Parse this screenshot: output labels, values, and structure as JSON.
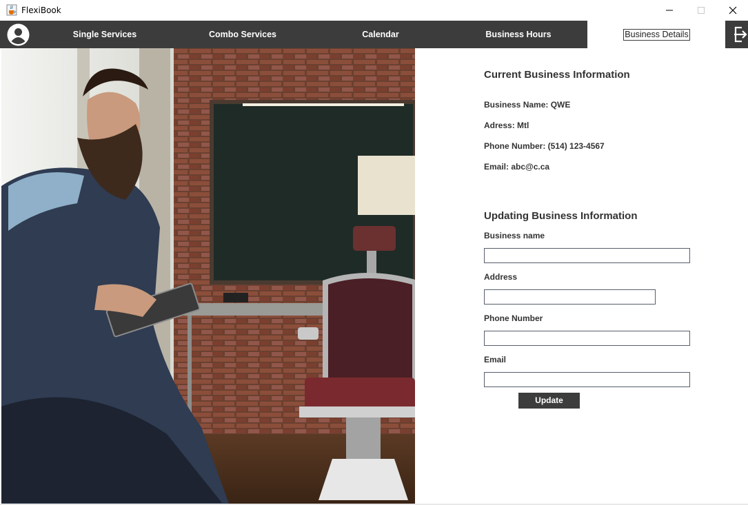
{
  "window": {
    "title": "FlexiBook"
  },
  "nav": {
    "items": [
      {
        "label": "Single Services"
      },
      {
        "label": "Combo Services"
      },
      {
        "label": "Calendar"
      },
      {
        "label": "Business Hours"
      },
      {
        "label": "Business Details"
      }
    ],
    "active_index": 4,
    "bar_color": "#3c3c3c"
  },
  "current": {
    "heading": "Current Business Information",
    "name_line": "Business Name: QWE",
    "address_line": "Adress: Mtl",
    "phone_line": "Phone Number: (514) 123-4567",
    "email_line": "Email: abc@c.ca"
  },
  "update": {
    "heading": "Updating Business Information",
    "name_label": "Business name",
    "address_label": "Address",
    "phone_label": "Phone Number",
    "email_label": "Email",
    "name_value": "",
    "address_value": "",
    "phone_value": "",
    "email_value": "",
    "button_label": "Update"
  },
  "icons": {
    "app": "java-coffee-icon",
    "avatar": "user-avatar-icon",
    "logout": "logout-icon",
    "minimize": "minimize-icon",
    "maximize": "maximize-icon",
    "close": "close-icon"
  }
}
